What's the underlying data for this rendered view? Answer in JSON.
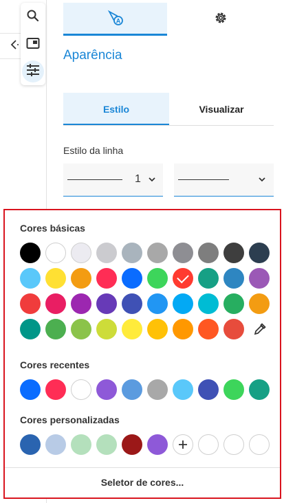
{
  "panel": {
    "title": "Aparência",
    "tabs": [
      {
        "icon": "shape-style-icon",
        "active": true
      },
      {
        "icon": "gear-icon",
        "active": false
      }
    ],
    "sub_tabs": [
      {
        "label": "Estilo",
        "active": true
      },
      {
        "label": "Visualizar",
        "active": false
      }
    ],
    "line_style": {
      "label": "Estilo da linha",
      "width_value": "1"
    }
  },
  "toolbar": {
    "buttons": [
      {
        "icon": "search-icon",
        "active": false
      },
      {
        "icon": "picture-in-picture-icon",
        "active": false
      },
      {
        "icon": "sliders-icon",
        "active": true
      }
    ]
  },
  "color_picker": {
    "basic_label": "Cores básicas",
    "basic_colors": [
      [
        "#000000",
        "#ffffff",
        "#ecebf1",
        "#cbcbcf",
        "#a9b4bd",
        "#a8a8a8",
        "#8e8e93",
        "#7e7e7e",
        "#3e3e3e",
        "#2c3e50"
      ],
      [
        "#5ac8fa",
        "#ffe033",
        "#f39c12",
        "#ff2d55",
        "#0a6cff",
        "#3dd55b",
        "#ff3b30",
        "#16a085",
        "#2e86c1",
        "#9b59b6"
      ],
      [
        "#f03c3c",
        "#e91e63",
        "#9c27b0",
        "#673ab7",
        "#3f51b5",
        "#2196f3",
        "#03a9f4",
        "#00bcd4",
        "#27ae60",
        "#f39c12"
      ],
      [
        "#009688",
        "#4caf50",
        "#8bc34a",
        "#cddc39",
        "#ffeb3b",
        "#ffc107",
        "#ff9800",
        "#ff5722",
        "#e74c3c"
      ]
    ],
    "selected_color": "#ff3b30",
    "recent_label": "Cores recentes",
    "recent_colors": [
      "#0a6cff",
      "#ff2d55",
      "#ffffff",
      "#8e59d8",
      "#5b9bdf",
      "#a8a8a8",
      "#5ac8fa",
      "#3f51b5",
      "#3dd55b",
      "#16a085"
    ],
    "custom_label": "Cores personalizadas",
    "custom_colors": [
      "#2a64b0",
      "#b8cbe6",
      "#b4e0bc",
      "#b4e0bc",
      "#9b1818",
      "#8e59d8"
    ],
    "empty_custom_slots": 3,
    "footer_button": "Seletor de cores..."
  }
}
